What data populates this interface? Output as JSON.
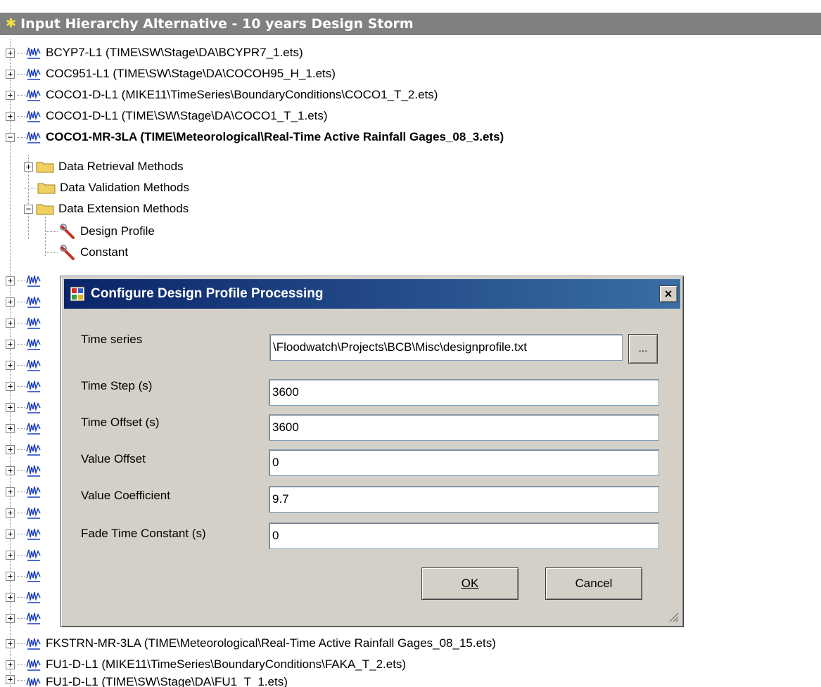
{
  "panel": {
    "title": "Input Hierarchy Alternative - 10 years Design Storm"
  },
  "tree": {
    "items": [
      {
        "label": "BCYP7-L1 (TIME\\SW\\Stage\\DA\\BCYPR7_1.ets)"
      },
      {
        "label": "COC951-L1 (TIME\\SW\\Stage\\DA\\COCOH95_H_1.ets)"
      },
      {
        "label": "COCO1-D-L1 (MIKE11\\TimeSeries\\BoundaryConditions\\COCO1_T_2.ets)"
      },
      {
        "label": "COCO1-D-L1 (TIME\\SW\\Stage\\DA\\COCO1_T_1.ets)"
      },
      {
        "label": "COCO1-MR-3LA (TIME\\Meteorological\\Real-Time Active Rainfall Gages_08_3.ets)"
      }
    ],
    "children": [
      {
        "label": "Data Retrieval Methods"
      },
      {
        "label": "Data Validation Methods"
      },
      {
        "label": "Data Extension Methods"
      }
    ],
    "methods": [
      {
        "label": "Design Profile"
      },
      {
        "label": "Constant"
      }
    ],
    "bottom_items": [
      {
        "label": "FKSTRN-MR-3LA (TIME\\Meteorological\\Real-Time Active Rainfall Gages_08_15.ets)"
      },
      {
        "label": "FU1-D-L1 (MIKE11\\TimeSeries\\BoundaryConditions\\FAKA_T_2.ets)"
      },
      {
        "label": "FU1-D-L1 (TIME\\SW\\Stage\\DA\\FU1_T_1.ets)"
      }
    ]
  },
  "dialog": {
    "title": "Configure Design Profile Processing",
    "close_label": "×",
    "fields": {
      "time_series": {
        "label": "Time series",
        "value": "\\Floodwatch\\Projects\\BCB\\Misc\\designprofile.txt"
      },
      "time_step": {
        "label": "Time Step (s)",
        "value": "3600"
      },
      "time_offset": {
        "label": "Time Offset (s)",
        "value": "3600"
      },
      "value_offset": {
        "label": "Value Offset",
        "value": "0"
      },
      "value_coefficient": {
        "label": "Value Coefficient",
        "value": "9.7"
      },
      "fade_time": {
        "label": "Fade Time Constant (s)",
        "value": "0"
      }
    },
    "browse_label": "...",
    "ok_label": "OK",
    "cancel_label": "Cancel"
  }
}
